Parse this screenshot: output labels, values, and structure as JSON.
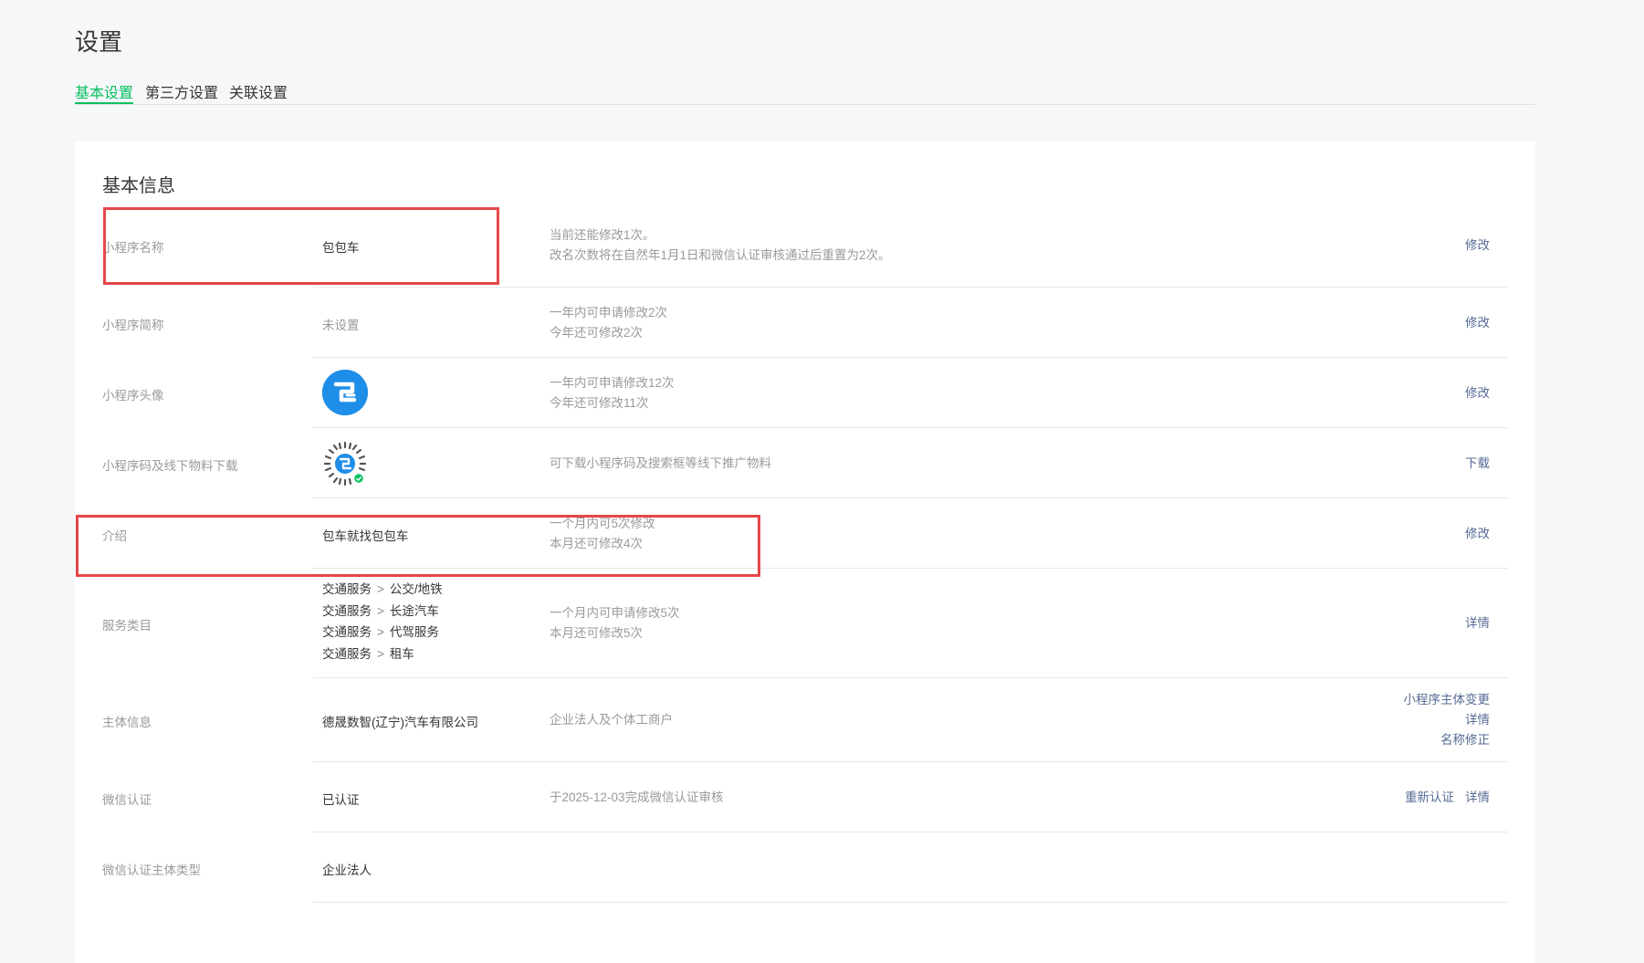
{
  "page": {
    "title": "设置"
  },
  "tabs": [
    {
      "label": "基本设置",
      "active": true
    },
    {
      "label": "第三方设置",
      "active": false
    },
    {
      "label": "关联设置",
      "active": false
    }
  ],
  "section": {
    "title": "基本信息"
  },
  "rows": {
    "name": {
      "label": "小程序名称",
      "value": "包包车",
      "desc1": "当前还能修改1次。",
      "desc2": "改名次数将在自然年1月1日和微信认证审核通过后重置为2次。",
      "action": "修改"
    },
    "short_name": {
      "label": "小程序简称",
      "value": "未设置",
      "desc1": "一年内可申请修改2次",
      "desc2": "今年还可修改2次",
      "action": "修改"
    },
    "avatar": {
      "label": "小程序头像",
      "icon": "bao-logo-avatar",
      "desc1": "一年内可申请修改12次",
      "desc2": "今年还可修改11次",
      "action": "修改"
    },
    "qrcode": {
      "label": "小程序码及线下物料下载",
      "icon": "mini-program-code",
      "desc1": "可下载小程序码及搜索框等线下推广物料",
      "action": "下载"
    },
    "intro": {
      "label": "介绍",
      "value": "包车就找包包车",
      "desc1": "一个月内可5次修改",
      "desc2": "本月还可修改4次",
      "action": "修改"
    },
    "service": {
      "label": "服务类目",
      "separator": ">",
      "items": [
        {
          "category": "交通服务",
          "sub": "公交/地铁"
        },
        {
          "category": "交通服务",
          "sub": "长途汽车"
        },
        {
          "category": "交通服务",
          "sub": "代驾服务"
        },
        {
          "category": "交通服务",
          "sub": "租车"
        }
      ],
      "desc1": "一个月内可申请修改5次",
      "desc2": "本月还可修改5次",
      "action": "详情"
    },
    "subject": {
      "label": "主体信息",
      "value": "德晟数智(辽宁)汽车有限公司",
      "desc1": "企业法人及个体工商户",
      "actions": [
        "小程序主体变更",
        "详情",
        "名称修正"
      ]
    },
    "wechat_verify": {
      "label": "微信认证",
      "value": "已认证",
      "desc1": "于2025-12-03完成微信认证审核",
      "actions": [
        "重新认证",
        "详情"
      ]
    },
    "verify_type": {
      "label": "微信认证主体类型",
      "value": "企业法人"
    },
    "partial": {
      "label": "",
      "value": ""
    }
  },
  "colors": {
    "accent": "#07c160",
    "link": "#576b95",
    "highlight": "#e5474a",
    "avatar": "#1e8ee8"
  }
}
